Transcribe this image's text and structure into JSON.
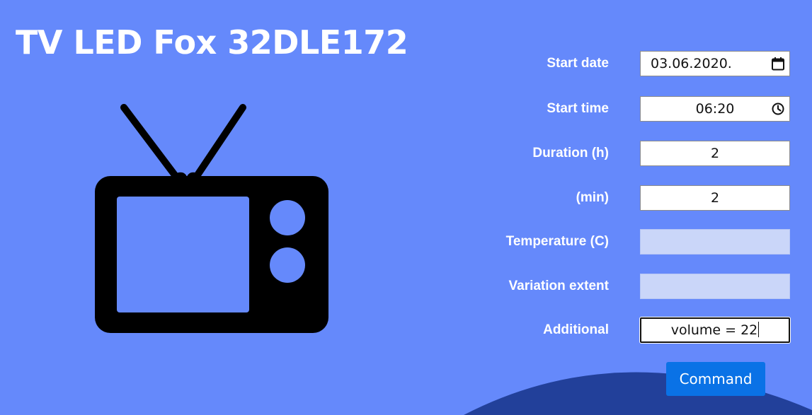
{
  "device": {
    "title": "TV LED Fox 32DLE172",
    "icon": "tv-icon"
  },
  "form": {
    "start_date": {
      "label": "Start date",
      "value": "03.06.2020.",
      "icon": "calendar-icon"
    },
    "start_time": {
      "label": "Start time",
      "value": "06:20",
      "icon": "clock-icon"
    },
    "duration_hours": {
      "label": "Duration (h)",
      "value": "2"
    },
    "duration_minutes": {
      "label": "(min)",
      "value": "2"
    },
    "temperature": {
      "label": "Temperature (C)",
      "value": "",
      "disabled": true
    },
    "variation_extent": {
      "label": "Variation extent",
      "value": "",
      "disabled": true
    },
    "additional": {
      "label": "Additional",
      "value": "volume = 22",
      "focused": true
    }
  },
  "actions": {
    "command_label": "Command"
  },
  "colors": {
    "background": "#6589fb",
    "wave": "#22409a",
    "button": "#0a72e6",
    "disabled_field": "#cad6f9"
  }
}
